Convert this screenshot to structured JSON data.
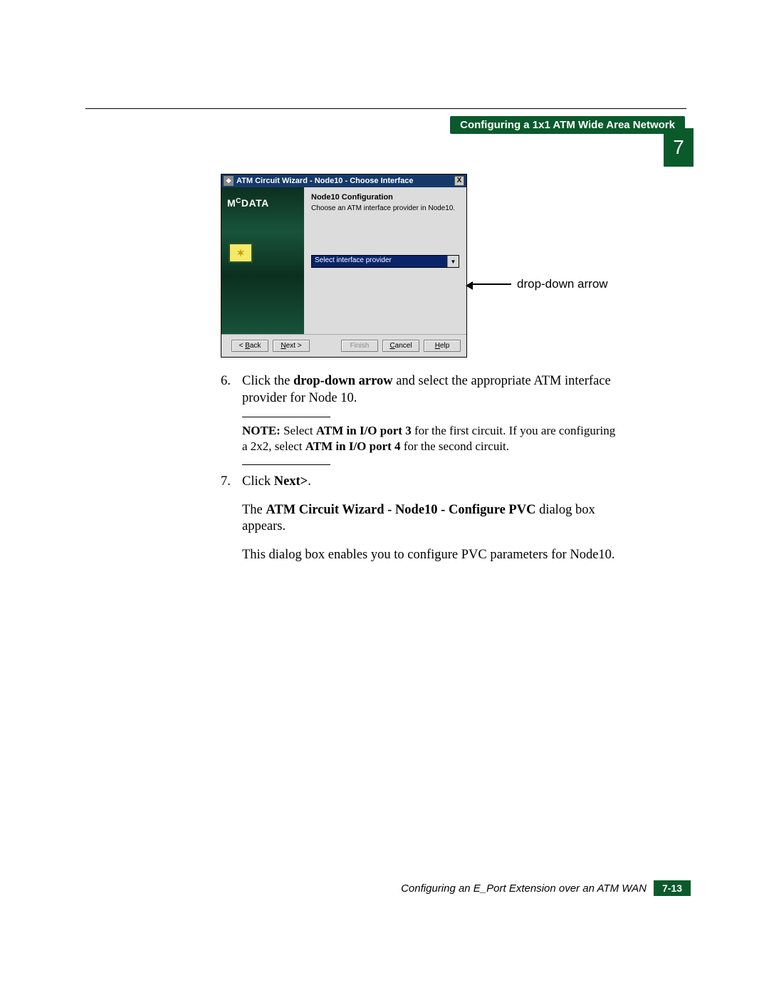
{
  "header": {
    "pill": "Configuring a 1x1 ATM Wide Area Network",
    "chapter": "7"
  },
  "dialog": {
    "title": "ATM Circuit Wizard - Node10 - Choose Interface",
    "close": "X",
    "brand": {
      "pre": "M",
      "small": "C",
      "rest": "DATA"
    },
    "content_heading": "Node10 Configuration",
    "content_sub": "Choose an ATM interface provider in Node10.",
    "combo_selected": "Select interface provider",
    "combo_glyph": "▼",
    "buttons": {
      "back_pre": "< ",
      "back_u": "B",
      "back_post": "ack",
      "next_u": "N",
      "next_post": "ext >",
      "finish": "Finish",
      "cancel_u": "C",
      "cancel_post": "ancel",
      "help_u": "H",
      "help_post": "elp"
    }
  },
  "annotation": "drop-down arrow",
  "steps": {
    "s6": {
      "n": "6.",
      "pre": "Click the ",
      "bold": "drop-down arrow",
      "post": " and select the appropriate ATM interface provider for Node 10."
    },
    "note": {
      "lead": "NOTE: ",
      "t1": "Select ",
      "b1": "ATM in I/O port 3",
      "t2": " for the first circuit. If you are configuring a 2x2, select ",
      "b2": "ATM in I/O port 4",
      "t3": " for the second circuit."
    },
    "s7": {
      "n": "7.",
      "pre": "Click ",
      "bold": "Next>",
      "post": "."
    },
    "p1": {
      "pre": "The ",
      "bold": "ATM Circuit Wizard - Node10 - Configure PVC",
      "post": " dialog box appears."
    },
    "p2": "This dialog box enables you to configure PVC parameters for Node10."
  },
  "footer": {
    "title": "Configuring an E_Port Extension over an ATM WAN",
    "page": "7-13"
  }
}
